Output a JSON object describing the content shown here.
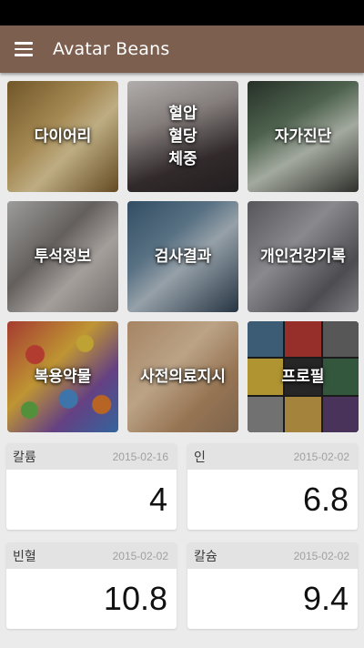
{
  "app": {
    "title": "Avatar Beans"
  },
  "tiles": [
    {
      "key": "diary",
      "label": "다이어리"
    },
    {
      "key": "bp",
      "label": "혈압\n혈당\n체중"
    },
    {
      "key": "self",
      "label": "자가진단"
    },
    {
      "key": "dialysis",
      "label": "투석정보"
    },
    {
      "key": "test",
      "label": "검사결과"
    },
    {
      "key": "record",
      "label": "개인건강기록"
    },
    {
      "key": "drug",
      "label": "복용약물"
    },
    {
      "key": "advance",
      "label": "사전의료지시"
    },
    {
      "key": "profile",
      "label": "프로필"
    }
  ],
  "cards": [
    {
      "name": "칼륨",
      "date": "2015-02-16",
      "value": "4"
    },
    {
      "name": "인",
      "date": "2015-02-02",
      "value": "6.8"
    },
    {
      "name": "빈혈",
      "date": "2015-02-02",
      "value": "10.8"
    },
    {
      "name": "칼슘",
      "date": "2015-02-02",
      "value": "9.4"
    }
  ]
}
